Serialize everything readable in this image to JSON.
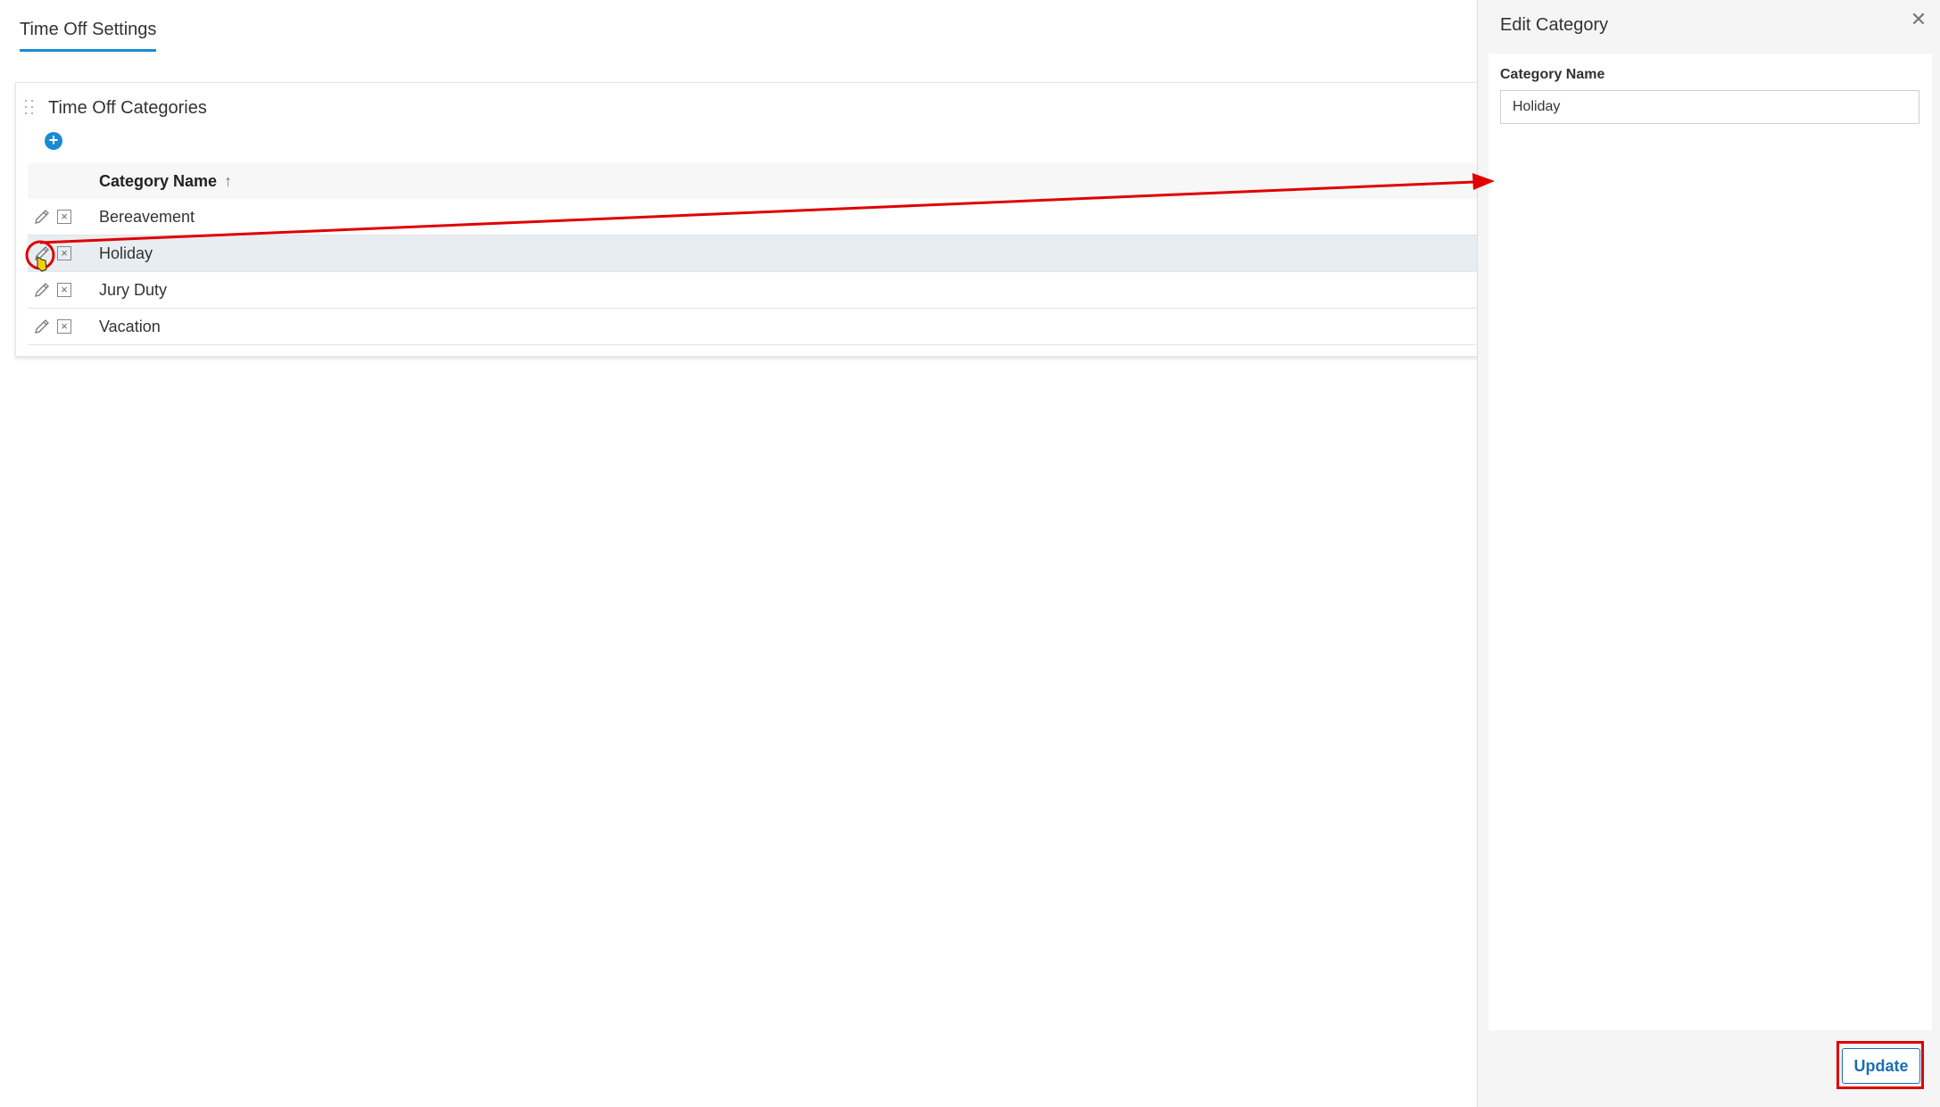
{
  "page": {
    "tab_label": "Time Off Settings"
  },
  "categories_card": {
    "title": "Time Off Categories",
    "add_icon": "plus-circle-icon",
    "column_header": "Category Name",
    "sort_icon": "sort-ascending-icon",
    "rows": [
      {
        "label": "Bereavement",
        "selected": false
      },
      {
        "label": "Holiday",
        "selected": true
      },
      {
        "label": "Jury Duty",
        "selected": false
      },
      {
        "label": "Vacation",
        "selected": false
      }
    ]
  },
  "edit_panel": {
    "title": "Edit Category",
    "field_label": "Category Name",
    "field_value": "Holiday",
    "update_label": "Update",
    "close_icon": "close-icon"
  },
  "colors": {
    "accent": "#1b8ad3",
    "selected_row": "#e8edf1",
    "annotation": "#e00000"
  }
}
